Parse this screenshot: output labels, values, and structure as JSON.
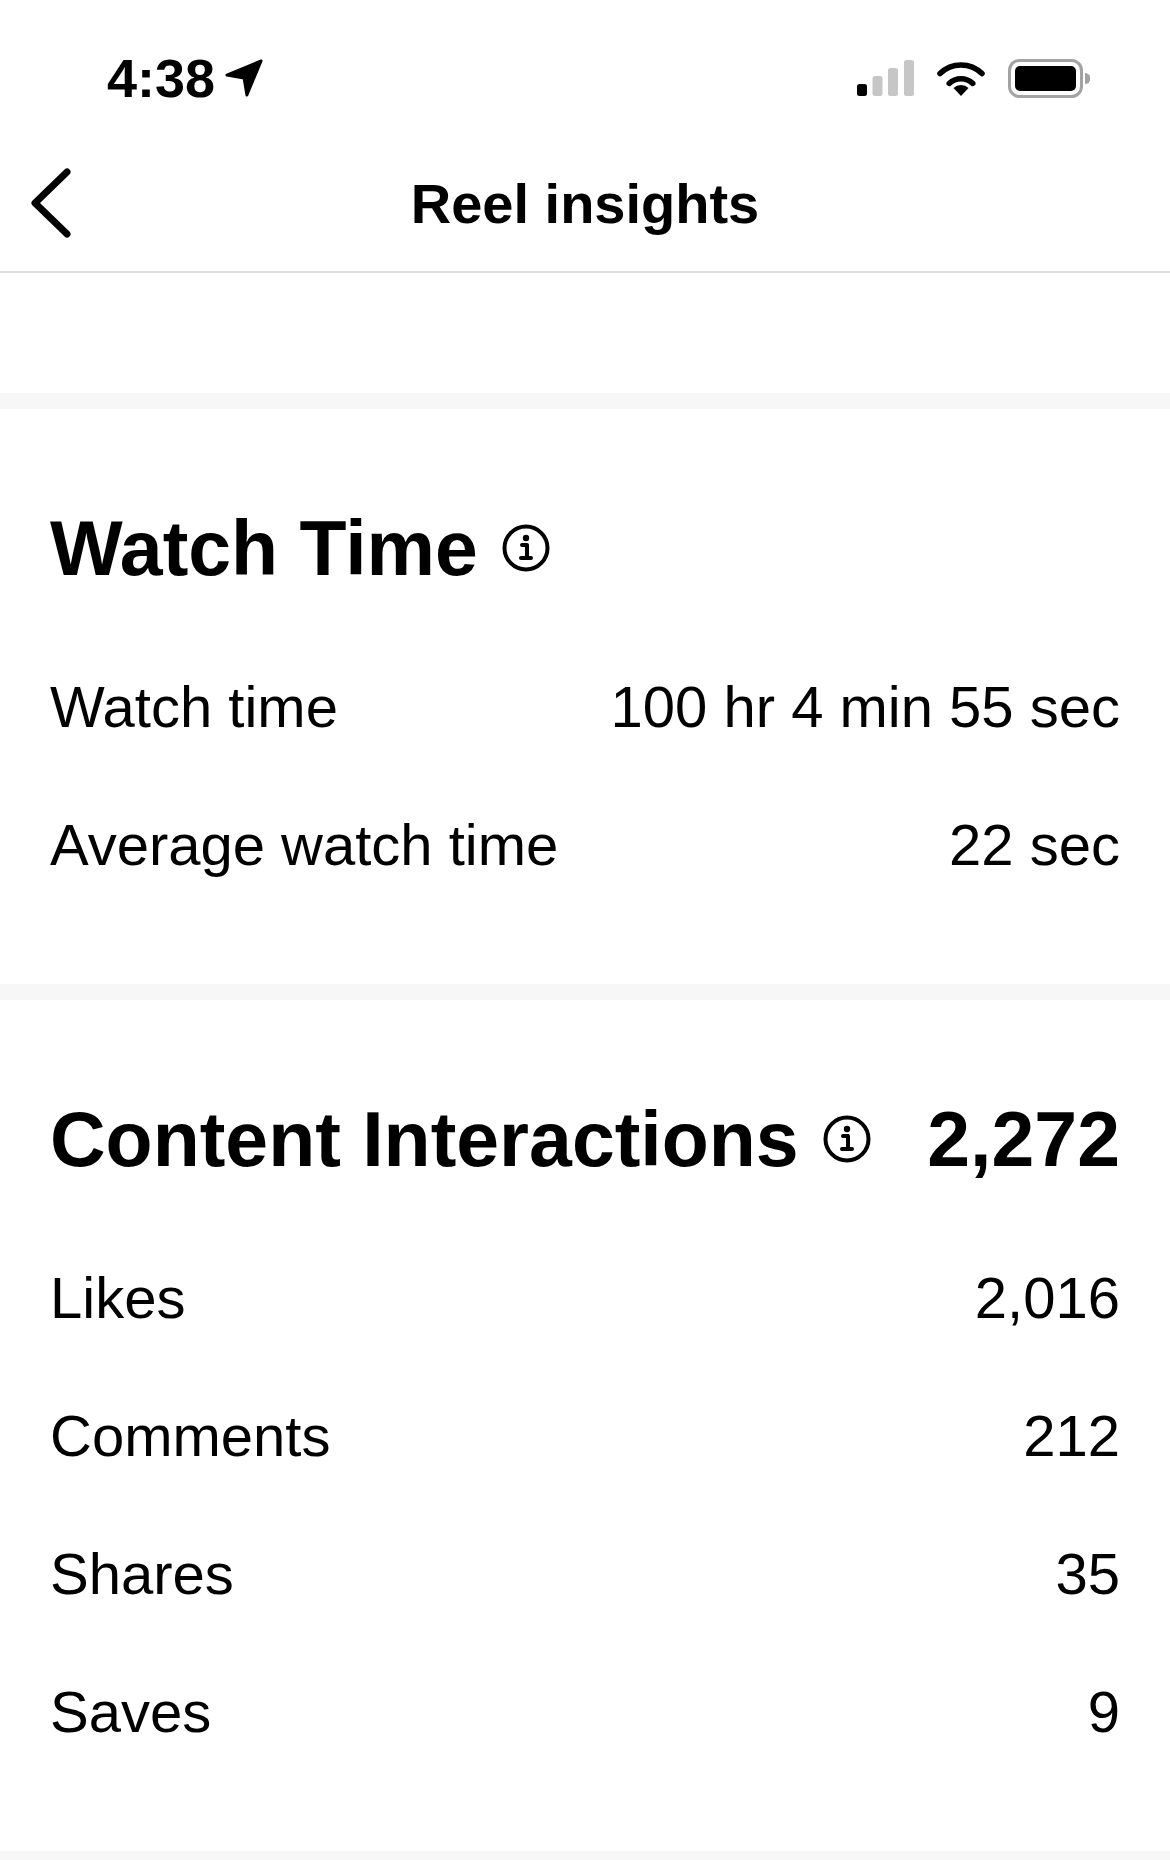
{
  "status_bar": {
    "time": "4:38"
  },
  "nav": {
    "title": "Reel insights"
  },
  "sections": [
    {
      "title": "Watch Time",
      "rows": [
        {
          "label": "Watch time",
          "value": "100 hr 4 min 55 sec"
        },
        {
          "label": "Average watch time",
          "value": "22 sec"
        }
      ]
    },
    {
      "title": "Content Interactions",
      "total": "2,272",
      "rows": [
        {
          "label": "Likes",
          "value": "2,016"
        },
        {
          "label": "Comments",
          "value": "212"
        },
        {
          "label": "Shares",
          "value": "35"
        },
        {
          "label": "Saves",
          "value": "9"
        }
      ]
    }
  ]
}
